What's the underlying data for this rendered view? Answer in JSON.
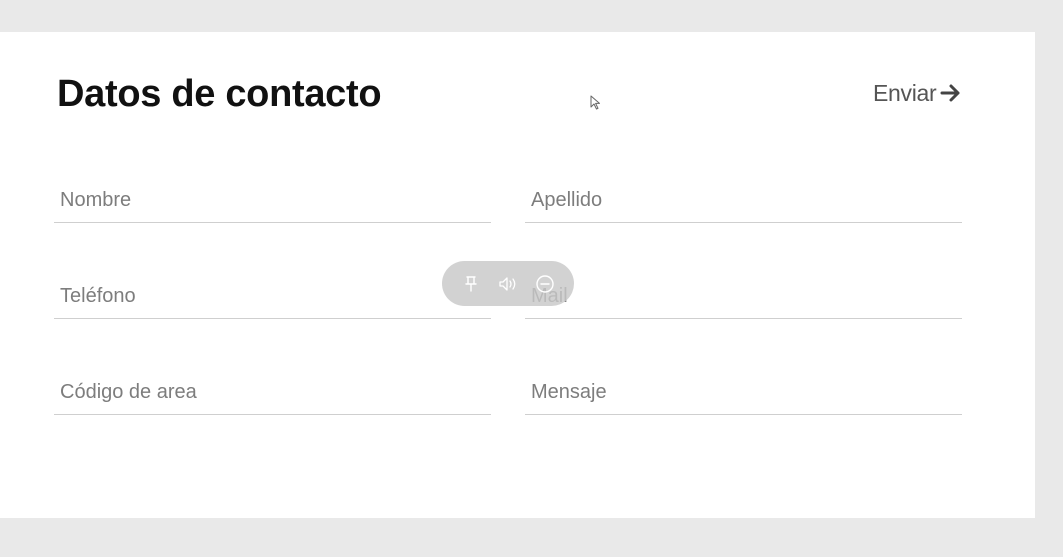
{
  "form": {
    "title": "Datos de contacto",
    "send_label": "Enviar",
    "fields": [
      {
        "name": "nombre",
        "placeholder": "Nombre",
        "value": ""
      },
      {
        "name": "apellido",
        "placeholder": "Apellido",
        "value": ""
      },
      {
        "name": "telefono",
        "placeholder": "Teléfono",
        "value": ""
      },
      {
        "name": "mail",
        "placeholder": "Mail",
        "value": ""
      },
      {
        "name": "codigo-area",
        "placeholder": "Código de area",
        "value": ""
      },
      {
        "name": "mensaje",
        "placeholder": "Mensaje",
        "value": ""
      }
    ]
  },
  "overlay": {
    "icons": [
      "pin-icon",
      "speaker-icon",
      "minus-circle-icon"
    ]
  },
  "colors": {
    "background": "#e9e9e9",
    "card": "#ffffff",
    "title": "#111111",
    "send": "#555555",
    "placeholder": "#7d7d7d",
    "underline": "#cfcfcf"
  }
}
